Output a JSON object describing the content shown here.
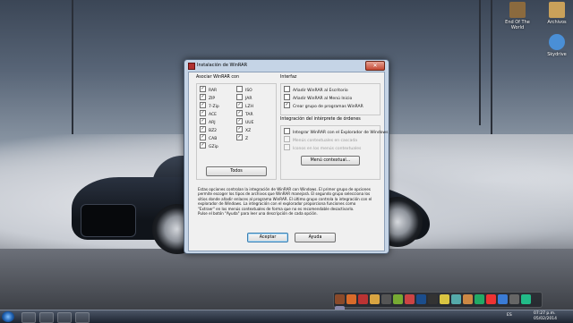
{
  "desktop": {
    "icons": [
      {
        "label": "End Of The World",
        "color": "#8b6a3e"
      },
      {
        "label": "Archivos",
        "color": "#c9a15a"
      },
      {
        "label": "Skydrive",
        "color": "#4a8fd6"
      }
    ]
  },
  "dialog": {
    "title": "Instalación de WinRAR",
    "close_glyph": "✕",
    "associate": {
      "label": "Asociar WinRAR con",
      "col1": [
        {
          "label": "RAR",
          "checked": true
        },
        {
          "label": "ZIP",
          "checked": true
        },
        {
          "label": "7-Zip",
          "checked": true
        },
        {
          "label": "ACE",
          "checked": true
        },
        {
          "label": "ARJ",
          "checked": true
        },
        {
          "label": "BZ2",
          "checked": true
        },
        {
          "label": "CAB",
          "checked": true
        },
        {
          "label": "GZip",
          "checked": true
        }
      ],
      "col2": [
        {
          "label": "ISO",
          "checked": false
        },
        {
          "label": "JAR",
          "checked": false
        },
        {
          "label": "LZH",
          "checked": true
        },
        {
          "label": "TAR",
          "checked": true
        },
        {
          "label": "UUE",
          "checked": true
        },
        {
          "label": "XZ",
          "checked": true
        },
        {
          "label": "Z",
          "checked": true
        }
      ],
      "all_button": "Todos"
    },
    "interface": {
      "label": "Interfaz",
      "items": [
        {
          "label": "Añadir WinRAR al Escritorio",
          "checked": false
        },
        {
          "label": "Añadir WinRAR al Menú Inicio",
          "checked": false
        },
        {
          "label": "Crear grupo de programas WinRAR",
          "checked": true
        }
      ]
    },
    "shell": {
      "label": "Integración del intérprete de órdenes",
      "items": [
        {
          "label": "Integrar WinRAR con el Explorador de Windows",
          "checked": false,
          "disabled": false
        },
        {
          "label": "Menús contextuales en cascada",
          "checked": false,
          "disabled": true
        },
        {
          "label": "Iconos en los menús contextuales",
          "checked": false,
          "disabled": true
        }
      ],
      "context_button": "Menú contextual..."
    },
    "description": "Estas opciones controlan la integración de WinRAR con Windows. El primer grupo de opciones permite escoger los tipos de archivos que WinRAR manejará. El segundo grupo selecciona los sitios donde añadir enlaces al programa WinRAR. El último grupo controla la integración con el explorador de Windows. La integración con  el explorador proporciona funciones como \"Extraer\" en los menús contextuales de forma que no es recomendable desactivarlo.",
    "description2": "Pulse el botón \"Ayuda\" para leer una descripción de cada opción.",
    "ok_button": "Aceptar",
    "help_button": "Ayuda"
  },
  "taskbar": {
    "lang": "ES",
    "time": "07:27 p.m.",
    "date": "05/02/2014"
  }
}
